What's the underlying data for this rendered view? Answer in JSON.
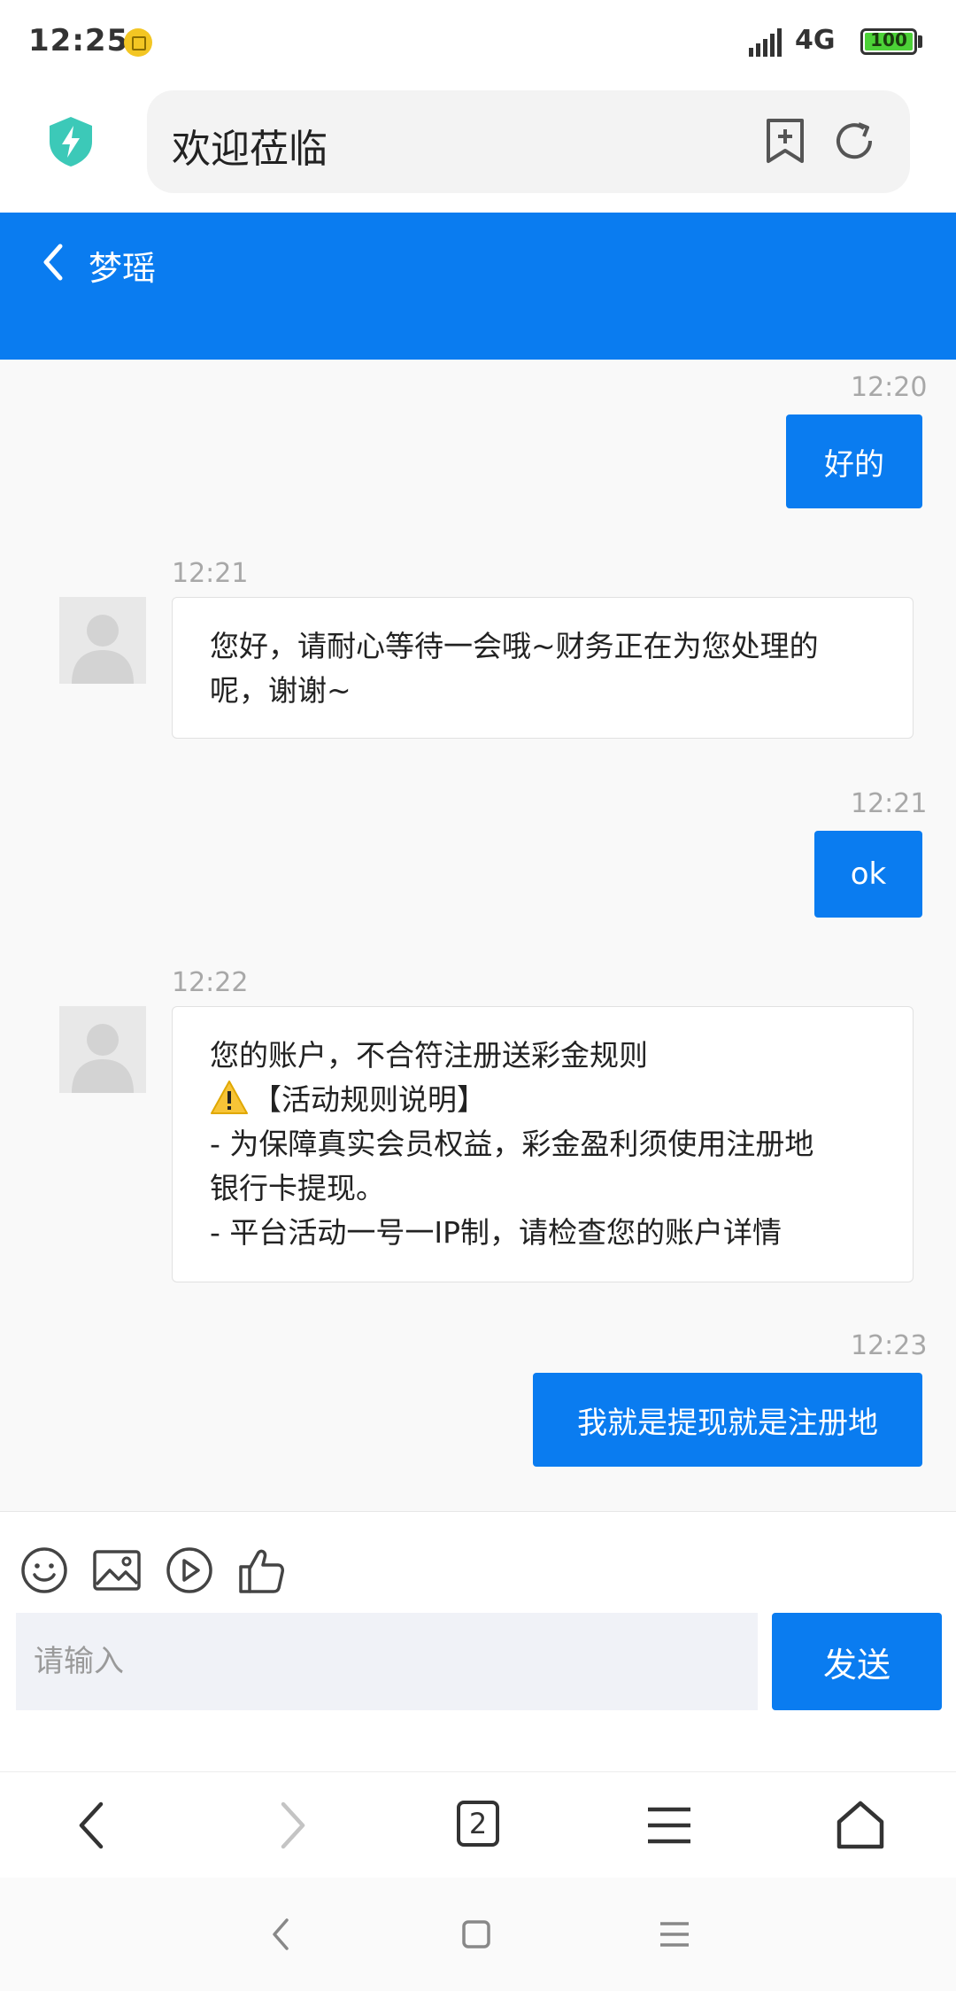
{
  "status_bar": {
    "time": "12:25",
    "network": "4G",
    "battery": "100"
  },
  "browser": {
    "url_title": "欢迎莅临"
  },
  "chat": {
    "title": "梦瑶",
    "messages": [
      {
        "dir": "out",
        "time": "12:20",
        "text": "好的"
      },
      {
        "dir": "in",
        "time": "12:21",
        "lines": [
          "您好，请耐心等待一会哦~财务正在为您处理的",
          "呢，谢谢~"
        ]
      },
      {
        "dir": "out",
        "time": "12:21",
        "text": "ok"
      },
      {
        "dir": "in",
        "time": "12:22",
        "lines": [
          "您的账户，不合符注册送彩金规则",
          "【活动规则说明】",
          "- 为保障真实会员权益，彩金盈利须使用注册地",
          "银行卡提现。",
          "- 平台活动一号一IP制，请检查您的账户详情"
        ]
      },
      {
        "dir": "out",
        "time": "12:23",
        "text": "我就是提现就是注册地"
      }
    ]
  },
  "composer": {
    "placeholder": "请输入",
    "send_label": "发送",
    "tools": [
      "emoji-icon",
      "image-icon",
      "video-icon",
      "thumbs-up-icon"
    ]
  },
  "browser_nav": {
    "tab_count": "2"
  },
  "colors": {
    "accent": "#0a7cf0",
    "chat_bg": "#f9f9f9"
  }
}
